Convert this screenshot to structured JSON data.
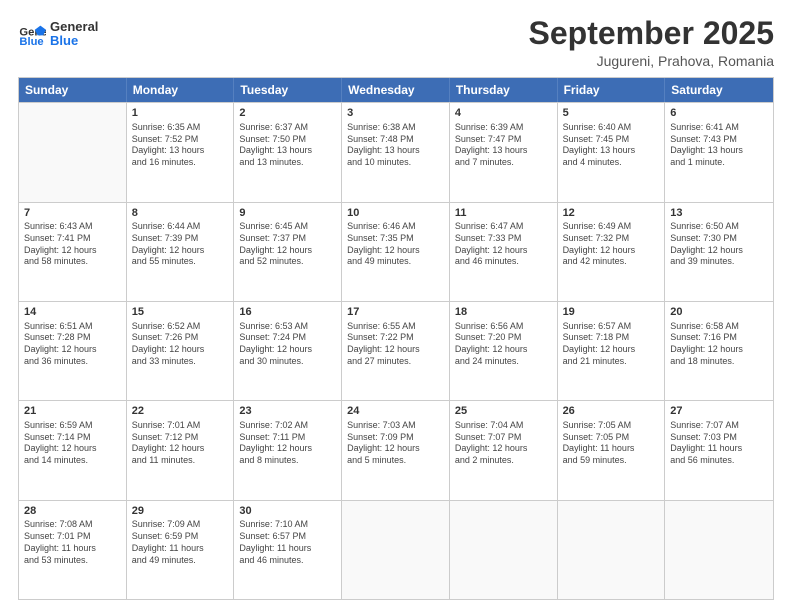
{
  "logo": {
    "line1": "General",
    "line2": "Blue"
  },
  "title": "September 2025",
  "subtitle": "Jugureni, Prahova, Romania",
  "days_of_week": [
    "Sunday",
    "Monday",
    "Tuesday",
    "Wednesday",
    "Thursday",
    "Friday",
    "Saturday"
  ],
  "weeks": [
    [
      {
        "day": "",
        "text": ""
      },
      {
        "day": "1",
        "text": "Sunrise: 6:35 AM\nSunset: 7:52 PM\nDaylight: 13 hours\nand 16 minutes."
      },
      {
        "day": "2",
        "text": "Sunrise: 6:37 AM\nSunset: 7:50 PM\nDaylight: 13 hours\nand 13 minutes."
      },
      {
        "day": "3",
        "text": "Sunrise: 6:38 AM\nSunset: 7:48 PM\nDaylight: 13 hours\nand 10 minutes."
      },
      {
        "day": "4",
        "text": "Sunrise: 6:39 AM\nSunset: 7:47 PM\nDaylight: 13 hours\nand 7 minutes."
      },
      {
        "day": "5",
        "text": "Sunrise: 6:40 AM\nSunset: 7:45 PM\nDaylight: 13 hours\nand 4 minutes."
      },
      {
        "day": "6",
        "text": "Sunrise: 6:41 AM\nSunset: 7:43 PM\nDaylight: 13 hours\nand 1 minute."
      }
    ],
    [
      {
        "day": "7",
        "text": "Sunrise: 6:43 AM\nSunset: 7:41 PM\nDaylight: 12 hours\nand 58 minutes."
      },
      {
        "day": "8",
        "text": "Sunrise: 6:44 AM\nSunset: 7:39 PM\nDaylight: 12 hours\nand 55 minutes."
      },
      {
        "day": "9",
        "text": "Sunrise: 6:45 AM\nSunset: 7:37 PM\nDaylight: 12 hours\nand 52 minutes."
      },
      {
        "day": "10",
        "text": "Sunrise: 6:46 AM\nSunset: 7:35 PM\nDaylight: 12 hours\nand 49 minutes."
      },
      {
        "day": "11",
        "text": "Sunrise: 6:47 AM\nSunset: 7:33 PM\nDaylight: 12 hours\nand 46 minutes."
      },
      {
        "day": "12",
        "text": "Sunrise: 6:49 AM\nSunset: 7:32 PM\nDaylight: 12 hours\nand 42 minutes."
      },
      {
        "day": "13",
        "text": "Sunrise: 6:50 AM\nSunset: 7:30 PM\nDaylight: 12 hours\nand 39 minutes."
      }
    ],
    [
      {
        "day": "14",
        "text": "Sunrise: 6:51 AM\nSunset: 7:28 PM\nDaylight: 12 hours\nand 36 minutes."
      },
      {
        "day": "15",
        "text": "Sunrise: 6:52 AM\nSunset: 7:26 PM\nDaylight: 12 hours\nand 33 minutes."
      },
      {
        "day": "16",
        "text": "Sunrise: 6:53 AM\nSunset: 7:24 PM\nDaylight: 12 hours\nand 30 minutes."
      },
      {
        "day": "17",
        "text": "Sunrise: 6:55 AM\nSunset: 7:22 PM\nDaylight: 12 hours\nand 27 minutes."
      },
      {
        "day": "18",
        "text": "Sunrise: 6:56 AM\nSunset: 7:20 PM\nDaylight: 12 hours\nand 24 minutes."
      },
      {
        "day": "19",
        "text": "Sunrise: 6:57 AM\nSunset: 7:18 PM\nDaylight: 12 hours\nand 21 minutes."
      },
      {
        "day": "20",
        "text": "Sunrise: 6:58 AM\nSunset: 7:16 PM\nDaylight: 12 hours\nand 18 minutes."
      }
    ],
    [
      {
        "day": "21",
        "text": "Sunrise: 6:59 AM\nSunset: 7:14 PM\nDaylight: 12 hours\nand 14 minutes."
      },
      {
        "day": "22",
        "text": "Sunrise: 7:01 AM\nSunset: 7:12 PM\nDaylight: 12 hours\nand 11 minutes."
      },
      {
        "day": "23",
        "text": "Sunrise: 7:02 AM\nSunset: 7:11 PM\nDaylight: 12 hours\nand 8 minutes."
      },
      {
        "day": "24",
        "text": "Sunrise: 7:03 AM\nSunset: 7:09 PM\nDaylight: 12 hours\nand 5 minutes."
      },
      {
        "day": "25",
        "text": "Sunrise: 7:04 AM\nSunset: 7:07 PM\nDaylight: 12 hours\nand 2 minutes."
      },
      {
        "day": "26",
        "text": "Sunrise: 7:05 AM\nSunset: 7:05 PM\nDaylight: 11 hours\nand 59 minutes."
      },
      {
        "day": "27",
        "text": "Sunrise: 7:07 AM\nSunset: 7:03 PM\nDaylight: 11 hours\nand 56 minutes."
      }
    ],
    [
      {
        "day": "28",
        "text": "Sunrise: 7:08 AM\nSunset: 7:01 PM\nDaylight: 11 hours\nand 53 minutes."
      },
      {
        "day": "29",
        "text": "Sunrise: 7:09 AM\nSunset: 6:59 PM\nDaylight: 11 hours\nand 49 minutes."
      },
      {
        "day": "30",
        "text": "Sunrise: 7:10 AM\nSunset: 6:57 PM\nDaylight: 11 hours\nand 46 minutes."
      },
      {
        "day": "",
        "text": ""
      },
      {
        "day": "",
        "text": ""
      },
      {
        "day": "",
        "text": ""
      },
      {
        "day": "",
        "text": ""
      }
    ]
  ]
}
